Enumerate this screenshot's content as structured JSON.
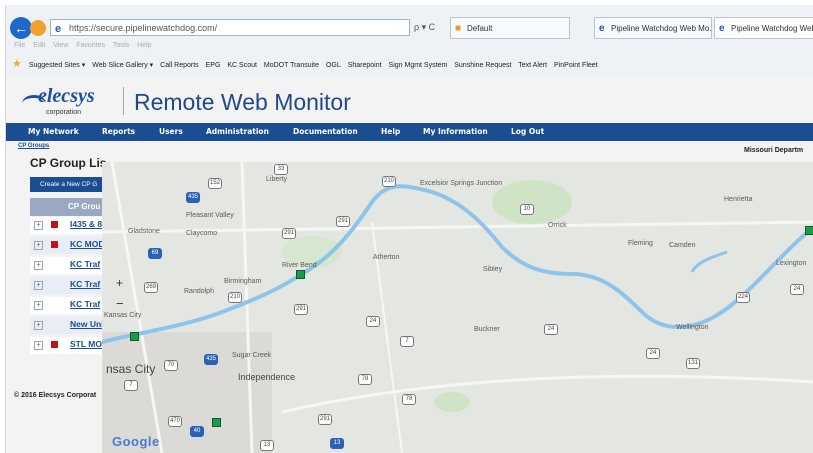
{
  "browser": {
    "url": "https://secure.pipelinewatchdog.com/",
    "search_button": "ρ",
    "refresh_button": "C",
    "tabs": [
      {
        "label": "Default"
      },
      {
        "label": "Pipeline Watchdog Web Mo..."
      },
      {
        "label": "Pipeline Watchdog Web"
      }
    ],
    "menu": [
      "File",
      "Edit",
      "View",
      "Favorites",
      "Tools",
      "Help"
    ],
    "favorites": [
      "Suggested Sites ▾",
      "Web Slice Gallery ▾",
      "Call Reports",
      "EPG",
      "KC Scout",
      "MoDOT Transuite",
      "OGL",
      "Sharepoint",
      "Sign Mgmt System",
      "Sunshine Request",
      "Text Alert",
      "PinPoint Fleet"
    ]
  },
  "header": {
    "logo_name": "elecsys",
    "logo_sub": "corporation",
    "title": "Remote Web Monitor"
  },
  "nav": [
    "My Network",
    "Reports",
    "Users",
    "Administration",
    "Documentation",
    "Help",
    "My Information",
    "Log Out"
  ],
  "breadcrumb": "CP Groups",
  "state_label": "Missouri Departm",
  "groups": {
    "title": "CP Group Lis",
    "create_button": "Create a New CP G",
    "column_header": "CP Grou",
    "rows": [
      "I435 & 8",
      "KC MOD",
      "KC Traf",
      "KC Traf",
      "KC Traf",
      "New Uni",
      "STL MO"
    ]
  },
  "copyright": "© 2016 Elecsys Corporat",
  "map": {
    "places": [
      "Liberty",
      "Excelsior Springs Junction",
      "Henrietta",
      "Pleasant Valley",
      "Gladstone",
      "Claycomo",
      "Orrick",
      "Fleming",
      "Camden",
      "Atherton",
      "River Bend",
      "Sibley",
      "Lexington",
      "Birmingham",
      "Randolph",
      "Kansas City",
      "Buckner",
      "Wellington",
      "Sugar Creek",
      "Independence",
      "nsas City"
    ],
    "routes": [
      "152",
      "33",
      "210",
      "10",
      "435",
      "291",
      "69",
      "291",
      "269",
      "210",
      "291",
      "24",
      "224",
      "24",
      "7",
      "24",
      "435",
      "24",
      "131",
      "78",
      "70",
      "7",
      "291",
      "470",
      "40",
      "78",
      "13",
      "13"
    ],
    "zoom_in": "+",
    "zoom_out": "−",
    "attribution": "Google",
    "river_color": "#8ec3ea",
    "marker_color": "#1e9a4c"
  }
}
